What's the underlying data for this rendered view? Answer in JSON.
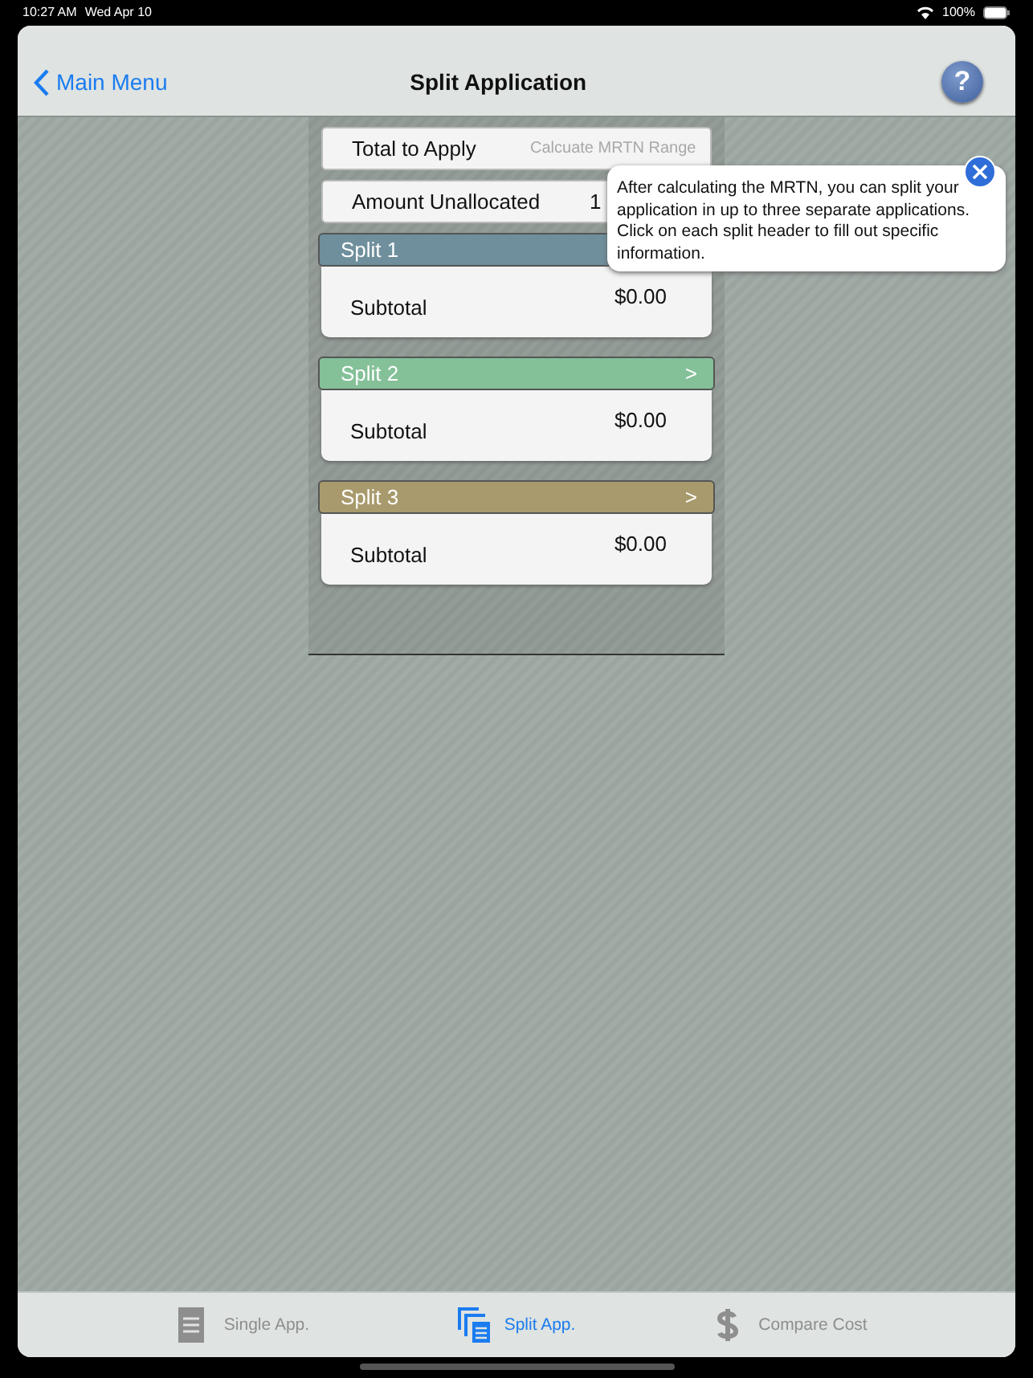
{
  "status_bar": {
    "time": "10:27 AM",
    "date": "Wed Apr 10",
    "battery": "100%"
  },
  "nav": {
    "back": "Main Menu",
    "title": "Split Application",
    "help": "?"
  },
  "fields": [
    {
      "label": "Total to Apply",
      "placeholder": "Calcuate MRTN Range"
    },
    {
      "label": "Amount Unallocated",
      "value": "1"
    }
  ],
  "splits": [
    {
      "title": "Split 1",
      "color": "#6f8f9c",
      "subtotal_label": "Subtotal",
      "subtotal": "$0.00"
    },
    {
      "title": "Split 2",
      "color": "#84c098",
      "arrow": ">",
      "subtotal_label": "Subtotal",
      "subtotal": "$0.00"
    },
    {
      "title": "Split 3",
      "color": "#a89a6c",
      "arrow": ">",
      "subtotal_label": "Subtotal",
      "subtotal": "$0.00"
    }
  ],
  "popover": {
    "text": "After calculating the MRTN, you can split your application in up to three separate applications. Click on each split header to fill out specific information."
  },
  "tabs": [
    {
      "kind": "single",
      "label": "Single App.",
      "selected": false
    },
    {
      "kind": "split",
      "label": "Split App.",
      "selected": true
    },
    {
      "kind": "cost",
      "label": "Compare Cost",
      "selected": false
    }
  ]
}
